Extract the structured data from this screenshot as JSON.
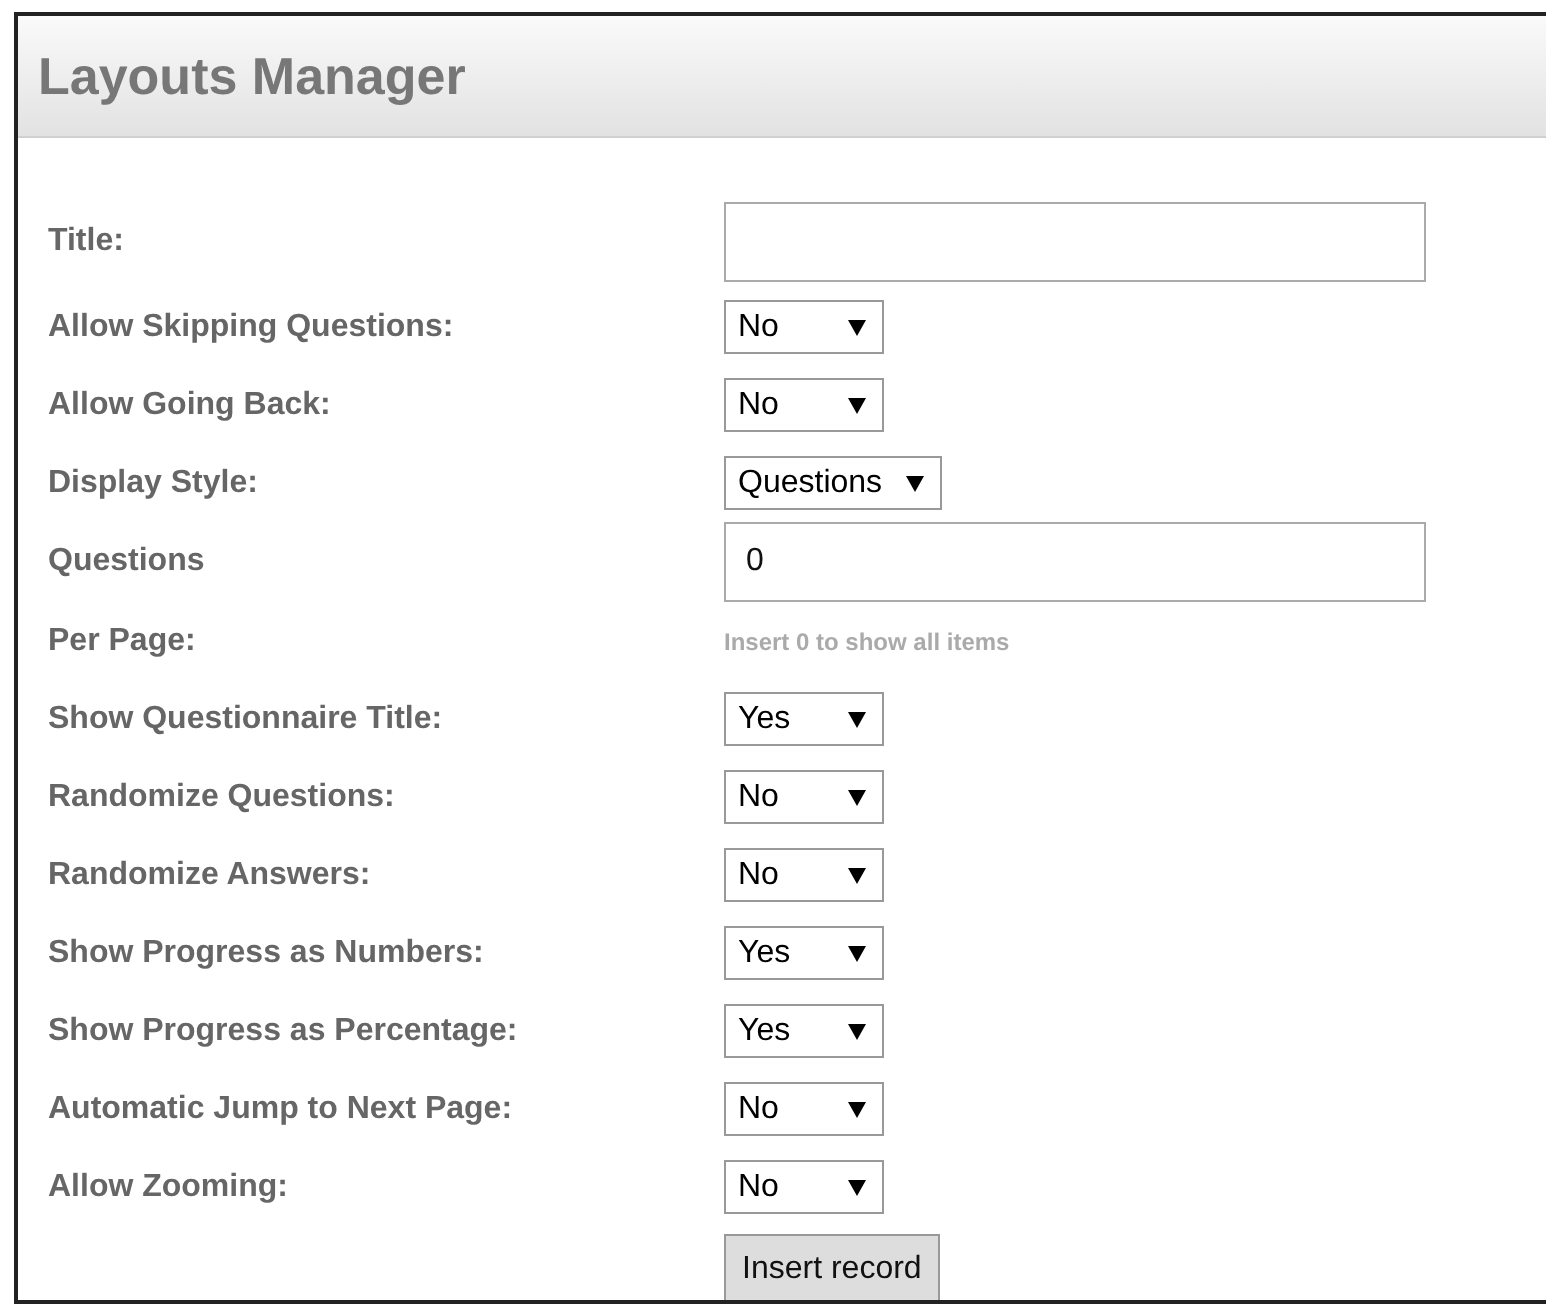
{
  "header": {
    "title": "Layouts Manager"
  },
  "fields": [
    {
      "kind": "text",
      "label": "Title:"
    },
    {
      "kind": "select",
      "label": "Allow Skipping Questions:",
      "value": "No"
    },
    {
      "kind": "select",
      "label": "Allow Going Back:",
      "value": "No"
    },
    {
      "kind": "select",
      "label": "Display Style:",
      "value": "Questions"
    },
    {
      "kind": "text",
      "label": "Questions",
      "value": "0"
    },
    {
      "kind": "hint",
      "label": "Per Page:",
      "hint": "Insert 0 to show all items"
    },
    {
      "kind": "select",
      "label": "Show Questionnaire Title:",
      "value": "Yes"
    },
    {
      "kind": "select",
      "label": "Randomize Questions:",
      "value": "No"
    },
    {
      "kind": "select",
      "label": "Randomize Answers:",
      "value": "No"
    },
    {
      "kind": "select",
      "label": "Show Progress as Numbers:",
      "value": "Yes"
    },
    {
      "kind": "select",
      "label": "Show Progress as Percentage:",
      "value": "Yes"
    },
    {
      "kind": "select",
      "label": "Automatic Jump to Next Page:",
      "value": "No"
    },
    {
      "kind": "select",
      "label": "Allow Zooming:",
      "value": "No"
    }
  ],
  "submit": {
    "label": "Insert record"
  }
}
